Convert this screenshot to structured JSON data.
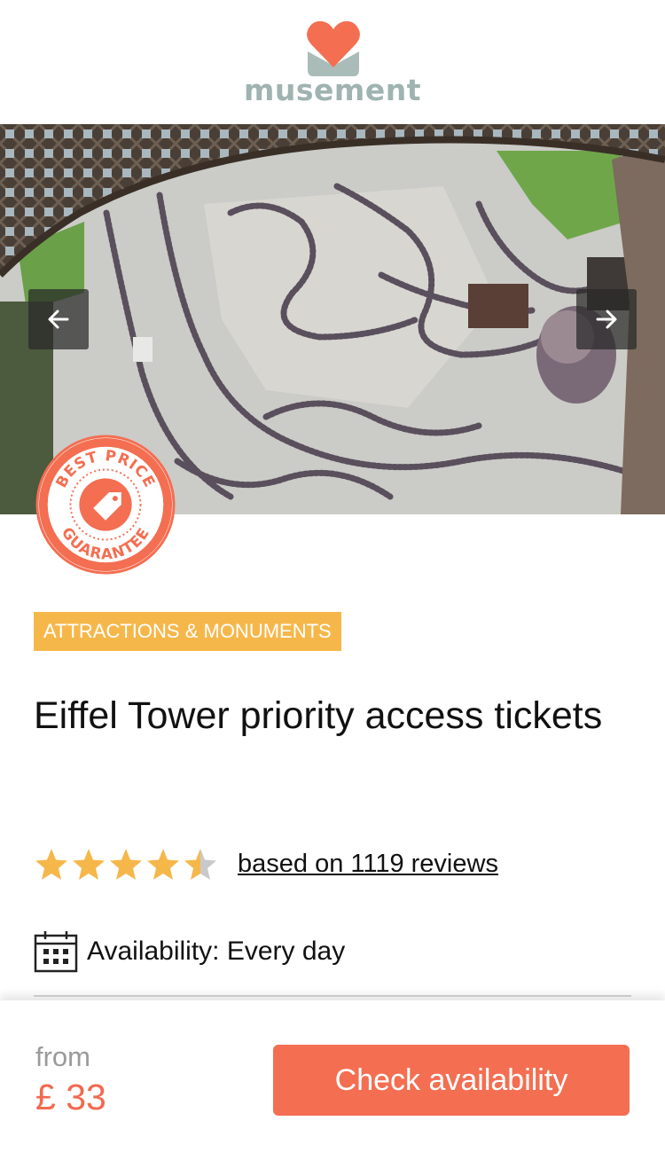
{
  "brand": {
    "name": "musement",
    "logo_icon": "heart-logo-icon"
  },
  "gallery": {
    "prev_icon": "arrow-left-icon",
    "next_icon": "arrow-right-icon",
    "image_alt": "aerial-crowd-under-eiffel-tower"
  },
  "badge": {
    "top_text": "BEST PRICE",
    "bottom_text": "GUARANTEE",
    "icon": "price-tag-icon",
    "color": "#f46e51"
  },
  "category": {
    "label": "ATTRACTIONS & MONUMENTS",
    "color": "#f6b74a"
  },
  "product": {
    "title": "Eiffel Tower priority access tickets"
  },
  "rating": {
    "value": 4.5,
    "max": 5,
    "reviews_label": "based on 1119 reviews",
    "star_color": "#f6b74a"
  },
  "availability": {
    "icon": "calendar-icon",
    "text": "Availability: Every day"
  },
  "footer": {
    "from_label": "from",
    "price": "£ 33",
    "cta_label": "Check availability",
    "accent": "#f46e51"
  }
}
